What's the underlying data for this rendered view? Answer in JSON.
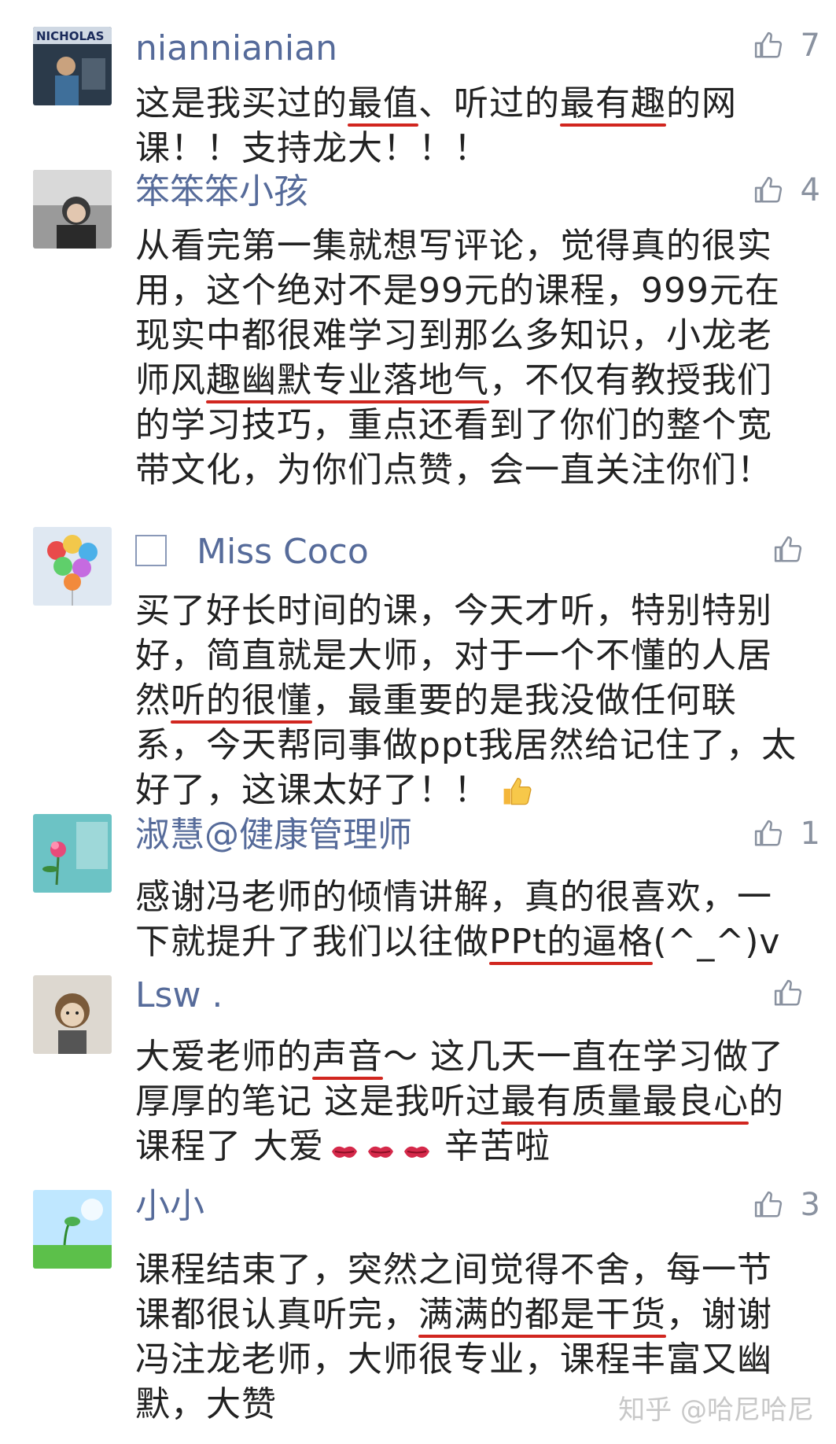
{
  "comments": [
    {
      "username": "niannianian",
      "likes": "7",
      "avatar_caption": "NICHOLAS",
      "text": [
        "这是我买过的",
        {
          "hl": "最值"
        },
        "、听过的",
        {
          "hl": "最有趣"
        },
        "的网\n课！！支持龙大！！！"
      ]
    },
    {
      "username": "笨笨笨小孩",
      "likes": "4",
      "text": [
        "从看完第一集就想写评论，觉得真的很实\n用，这个绝对不是99元的课程，999元在\n现实中都很难学习到那么多知识，小龙老\n师风",
        {
          "hl": "趣幽默专业落地气"
        },
        "，不仅有教授我们\n的学习技巧，重点还看到了你们的整个宽\n带文化，为你们点赞，会一直关注你们！"
      ]
    },
    {
      "username": "Miss Coco",
      "likes": "",
      "text": [
        "买了好长时间的课，今天才听，特别特别\n好，简直就是大师，对于一个不懂的人居\n然",
        {
          "hl": "听的很懂"
        },
        "，最重要的是我没做任何联\n系，今天帮同事做ppt我居然给记住了，太\n好了，这课太好了！！"
      ]
    },
    {
      "username": "淑慧@健康管理师",
      "likes": "1",
      "text": [
        "感谢冯老师的倾情讲解，真的很喜欢，一\n下就提升了我们以往做",
        {
          "hl": "PPt的逼格"
        },
        "(^_^)v"
      ]
    },
    {
      "username": "Lsw .",
      "likes": "",
      "text": [
        "大爱老师的",
        {
          "hl": "声音"
        },
        "～ 这几天一直在学习做了\n厚厚的笔记 这是我听过",
        {
          "hl": "最有质量最良心"
        },
        "的\n课程了 大爱",
        {
          "kiss": 3
        },
        " 辛苦啦"
      ]
    },
    {
      "username": "小小",
      "likes": "3",
      "text": [
        "课程结束了，突然之间觉得不舍，每一节\n课都很认真听完，",
        {
          "hl": "满满的都是干货"
        },
        "，谢谢\n冯注龙老师，大师很专业，课程丰富又幽\n默，大赞"
      ]
    }
  ],
  "watermark": "知乎 @哈尼哈尼",
  "colors": {
    "username": "#566b9a",
    "underline": "#d1261f",
    "like_icon": "#8a92a0"
  }
}
